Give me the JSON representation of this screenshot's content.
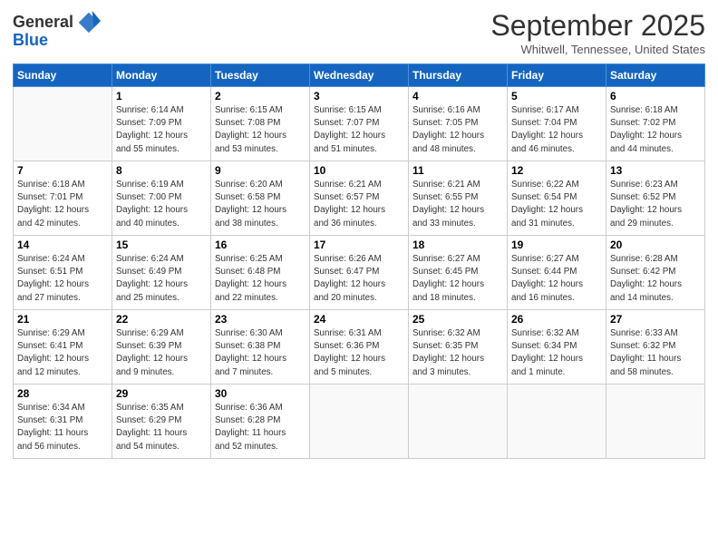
{
  "header": {
    "logo_line1": "General",
    "logo_line2": "Blue",
    "month_title": "September 2025",
    "location": "Whitwell, Tennessee, United States"
  },
  "days_of_week": [
    "Sunday",
    "Monday",
    "Tuesday",
    "Wednesday",
    "Thursday",
    "Friday",
    "Saturday"
  ],
  "weeks": [
    [
      {
        "day": "",
        "info": ""
      },
      {
        "day": "1",
        "info": "Sunrise: 6:14 AM\nSunset: 7:09 PM\nDaylight: 12 hours\nand 55 minutes."
      },
      {
        "day": "2",
        "info": "Sunrise: 6:15 AM\nSunset: 7:08 PM\nDaylight: 12 hours\nand 53 minutes."
      },
      {
        "day": "3",
        "info": "Sunrise: 6:15 AM\nSunset: 7:07 PM\nDaylight: 12 hours\nand 51 minutes."
      },
      {
        "day": "4",
        "info": "Sunrise: 6:16 AM\nSunset: 7:05 PM\nDaylight: 12 hours\nand 48 minutes."
      },
      {
        "day": "5",
        "info": "Sunrise: 6:17 AM\nSunset: 7:04 PM\nDaylight: 12 hours\nand 46 minutes."
      },
      {
        "day": "6",
        "info": "Sunrise: 6:18 AM\nSunset: 7:02 PM\nDaylight: 12 hours\nand 44 minutes."
      }
    ],
    [
      {
        "day": "7",
        "info": "Sunrise: 6:18 AM\nSunset: 7:01 PM\nDaylight: 12 hours\nand 42 minutes."
      },
      {
        "day": "8",
        "info": "Sunrise: 6:19 AM\nSunset: 7:00 PM\nDaylight: 12 hours\nand 40 minutes."
      },
      {
        "day": "9",
        "info": "Sunrise: 6:20 AM\nSunset: 6:58 PM\nDaylight: 12 hours\nand 38 minutes."
      },
      {
        "day": "10",
        "info": "Sunrise: 6:21 AM\nSunset: 6:57 PM\nDaylight: 12 hours\nand 36 minutes."
      },
      {
        "day": "11",
        "info": "Sunrise: 6:21 AM\nSunset: 6:55 PM\nDaylight: 12 hours\nand 33 minutes."
      },
      {
        "day": "12",
        "info": "Sunrise: 6:22 AM\nSunset: 6:54 PM\nDaylight: 12 hours\nand 31 minutes."
      },
      {
        "day": "13",
        "info": "Sunrise: 6:23 AM\nSunset: 6:52 PM\nDaylight: 12 hours\nand 29 minutes."
      }
    ],
    [
      {
        "day": "14",
        "info": "Sunrise: 6:24 AM\nSunset: 6:51 PM\nDaylight: 12 hours\nand 27 minutes."
      },
      {
        "day": "15",
        "info": "Sunrise: 6:24 AM\nSunset: 6:49 PM\nDaylight: 12 hours\nand 25 minutes."
      },
      {
        "day": "16",
        "info": "Sunrise: 6:25 AM\nSunset: 6:48 PM\nDaylight: 12 hours\nand 22 minutes."
      },
      {
        "day": "17",
        "info": "Sunrise: 6:26 AM\nSunset: 6:47 PM\nDaylight: 12 hours\nand 20 minutes."
      },
      {
        "day": "18",
        "info": "Sunrise: 6:27 AM\nSunset: 6:45 PM\nDaylight: 12 hours\nand 18 minutes."
      },
      {
        "day": "19",
        "info": "Sunrise: 6:27 AM\nSunset: 6:44 PM\nDaylight: 12 hours\nand 16 minutes."
      },
      {
        "day": "20",
        "info": "Sunrise: 6:28 AM\nSunset: 6:42 PM\nDaylight: 12 hours\nand 14 minutes."
      }
    ],
    [
      {
        "day": "21",
        "info": "Sunrise: 6:29 AM\nSunset: 6:41 PM\nDaylight: 12 hours\nand 12 minutes."
      },
      {
        "day": "22",
        "info": "Sunrise: 6:29 AM\nSunset: 6:39 PM\nDaylight: 12 hours\nand 9 minutes."
      },
      {
        "day": "23",
        "info": "Sunrise: 6:30 AM\nSunset: 6:38 PM\nDaylight: 12 hours\nand 7 minutes."
      },
      {
        "day": "24",
        "info": "Sunrise: 6:31 AM\nSunset: 6:36 PM\nDaylight: 12 hours\nand 5 minutes."
      },
      {
        "day": "25",
        "info": "Sunrise: 6:32 AM\nSunset: 6:35 PM\nDaylight: 12 hours\nand 3 minutes."
      },
      {
        "day": "26",
        "info": "Sunrise: 6:32 AM\nSunset: 6:34 PM\nDaylight: 12 hours\nand 1 minute."
      },
      {
        "day": "27",
        "info": "Sunrise: 6:33 AM\nSunset: 6:32 PM\nDaylight: 11 hours\nand 58 minutes."
      }
    ],
    [
      {
        "day": "28",
        "info": "Sunrise: 6:34 AM\nSunset: 6:31 PM\nDaylight: 11 hours\nand 56 minutes."
      },
      {
        "day": "29",
        "info": "Sunrise: 6:35 AM\nSunset: 6:29 PM\nDaylight: 11 hours\nand 54 minutes."
      },
      {
        "day": "30",
        "info": "Sunrise: 6:36 AM\nSunset: 6:28 PM\nDaylight: 11 hours\nand 52 minutes."
      },
      {
        "day": "",
        "info": ""
      },
      {
        "day": "",
        "info": ""
      },
      {
        "day": "",
        "info": ""
      },
      {
        "day": "",
        "info": ""
      }
    ]
  ]
}
